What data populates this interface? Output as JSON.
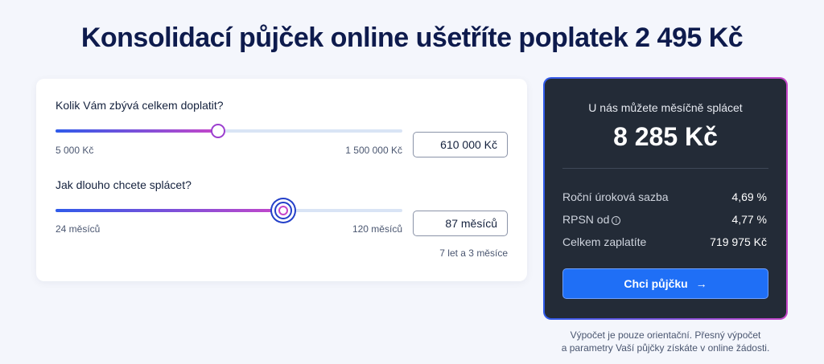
{
  "header": {
    "title": "Konsolidací půjček online ušetříte poplatek 2 495 Kč"
  },
  "calculator": {
    "amount": {
      "question": "Kolik Vám zbývá celkem doplatit?",
      "min_label": "5 000 Kč",
      "max_label": "1 500 000 Kč",
      "value": "610 000 Kč",
      "slider_fraction": 0.468
    },
    "term": {
      "question": "Jak dlouho chcete splácet?",
      "min_label": "24 měsíců",
      "max_label": "120 měsíců",
      "value": "87 měsíců",
      "slider_fraction": 0.656,
      "duration_text": "7 let a 3 měsíce"
    }
  },
  "summary": {
    "heading": "U nás můžete měsíčně splácet",
    "monthly_amount": "8 285 Kč",
    "rows": [
      {
        "label": "Roční úroková sazba",
        "value": "4,69 %"
      },
      {
        "label": "RPSN od",
        "value": "4,77 %",
        "icon": "info-icon"
      },
      {
        "label": "Celkem zaplatíte",
        "value": "719 975 Kč"
      }
    ],
    "cta_label": "Chci půjčku",
    "cta_icon": "arrow-right-icon"
  },
  "disclaimer": {
    "line1": "Výpočet je pouze orientační. Přesný výpočet",
    "line2": "a parametry Vaší půjčky získáte v online žádosti."
  },
  "colors": {
    "accent": "#1f6ff6",
    "gradient_start": "#2f5bea",
    "gradient_end": "#c646c9",
    "panel_bg": "#232b37"
  }
}
